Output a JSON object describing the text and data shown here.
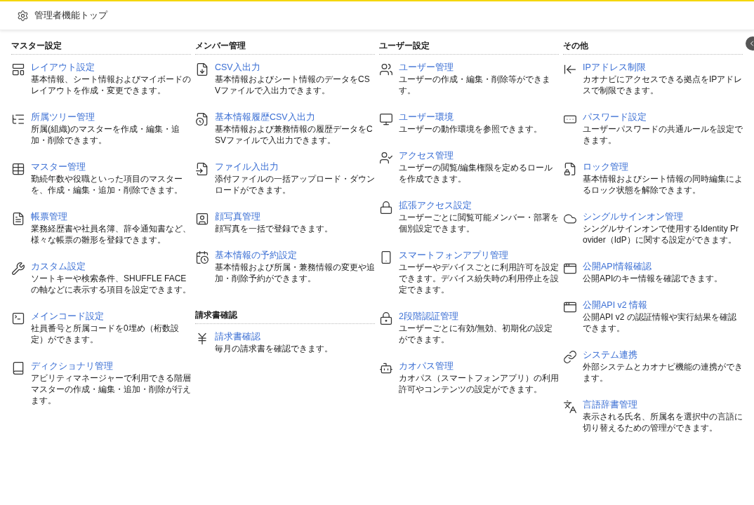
{
  "header": {
    "title": "管理者機能トップ"
  },
  "columns": [
    {
      "sections": [
        {
          "title": "マスター設定",
          "items": [
            {
              "title": "レイアウト設定",
              "description": "基本情報、シート情報およびマイボードのレイアウトを作成・変更できます。"
            },
            {
              "title": "所属ツリー管理",
              "description": "所属(組織)のマスターを作成・編集・追加・削除できます。"
            },
            {
              "title": "マスター管理",
              "description": "勤続年数や役職といった項目のマスターを、作成・編集・追加・削除できます。"
            },
            {
              "title": "帳票管理",
              "description": "業務経歴書や社員名簿、辞令通知書など、様々な帳票の雛形を登録できます。"
            },
            {
              "title": "カスタム設定",
              "description": "ソートキーや検索条件、SHUFFLE FACEの軸などに表示する項目を設定できます。"
            },
            {
              "title": "メインコード設定",
              "description": "社員番号と所属コードを0埋め（桁数設定）ができます。"
            },
            {
              "title": "ディクショナリ管理",
              "description": "アビリティマネージャーで利用できる階層マスターの作成・編集・追加・削除が行えます。"
            }
          ]
        }
      ]
    },
    {
      "sections": [
        {
          "title": "メンバー管理",
          "items": [
            {
              "title": "CSV入出力",
              "description": "基本情報およびシート情報のデータをCSVファイルで入出力できます。"
            },
            {
              "title": "基本情報履歴CSV入出力",
              "description": "基本情報および兼務情報の履歴データをCSVファイルで入出力できます。"
            },
            {
              "title": "ファイル入出力",
              "description": "添付ファイルの一括アップロード・ダウンロードができます。"
            },
            {
              "title": "顔写真管理",
              "description": "顔写真を一括で登録できます。"
            },
            {
              "title": "基本情報の予約設定",
              "description": "基本情報および所属・兼務情報の変更や追加・削除予約ができます。"
            }
          ]
        },
        {
          "title": "請求書確認",
          "items": [
            {
              "title": "請求書確認",
              "description": "毎月の請求書を確認できます。"
            }
          ]
        }
      ]
    },
    {
      "sections": [
        {
          "title": "ユーザー設定",
          "items": [
            {
              "title": "ユーザー管理",
              "description": "ユーザーの作成・編集・削除等ができます。"
            },
            {
              "title": "ユーザー環境",
              "description": "ユーザーの動作環境を参照できます。"
            },
            {
              "title": "アクセス管理",
              "description": "ユーザーの閲覧/編集権限を定めるロールを作成できます。"
            },
            {
              "title": "拡張アクセス設定",
              "description": "ユーザーごとに閲覧可能メンバー・部署を個別設定できます。"
            },
            {
              "title": "スマートフォンアプリ管理",
              "description": "ユーザーやデバイスごとに利用許可を設定できます。デバイス紛失時の利用停止を設定できます。"
            },
            {
              "title": "2段階認証管理",
              "description": "ユーザーごとに有効/無効、初期化の設定ができます。"
            },
            {
              "title": "カオパス管理",
              "description": "カオパス（スマートフォンアプリ）の利用許可やコンテンツの設定ができます。"
            }
          ]
        }
      ]
    },
    {
      "sections": [
        {
          "title": "その他",
          "items": [
            {
              "title": "IPアドレス制限",
              "description": "カオナビにアクセスできる拠点をIPアドレスで制限できます。"
            },
            {
              "title": "パスワード設定",
              "description": "ユーザーパスワードの共通ルールを設定できます。"
            },
            {
              "title": "ロック管理",
              "description": "基本情報およびシート情報の同時編集によるロック状態を解除できます。"
            },
            {
              "title": "シングルサインオン管理",
              "description": "シングルサインオンで使用するIdentity Provider（IdP）に関する設定ができます。"
            },
            {
              "title": "公開API情報確認",
              "description": "公開APIのキー情報を確認できます。"
            },
            {
              "title": "公開API v2 情報",
              "description": "公開API v2 の認証情報や実行結果を確認できます。"
            },
            {
              "title": "システム連携",
              "description": "外部システムとカオナビ機能の連携ができます。"
            },
            {
              "title": "言語辞書管理",
              "description": "表示される氏名、所属名を選択中の言語に切り替えるための管理ができます。"
            }
          ]
        }
      ]
    }
  ]
}
